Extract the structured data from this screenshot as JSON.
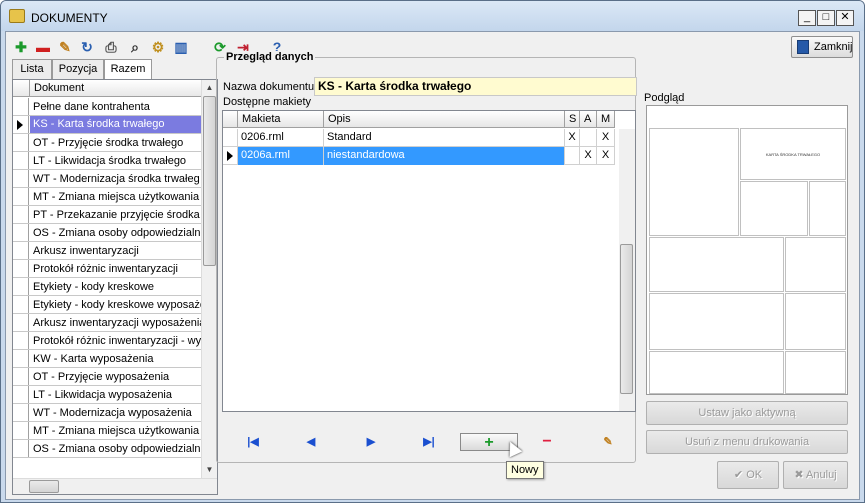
{
  "window": {
    "title": "DOKUMENTY",
    "minimize": "_",
    "maximize": "□",
    "close": "✕"
  },
  "toolbar": {
    "icons": [
      "add-icon",
      "remove-icon",
      "edit-icon",
      "refresh-doc-icon",
      "print-icon",
      "search-icon",
      "settings-icon",
      "columns-icon",
      "reload-icon",
      "import-icon",
      "help-icon"
    ],
    "close_label": "Zamknij"
  },
  "tabs": [
    {
      "label": "Lista"
    },
    {
      "label": "Pozycja"
    },
    {
      "label": "Razem"
    }
  ],
  "left_list": {
    "header": "Dokument",
    "rows": [
      "Pełne dane kontrahenta",
      "KS - Karta środka trwałego",
      "OT - Przyjęcie środka trwałego",
      "LT - Likwidacja środka trwałego",
      "WT - Modernizacja środka trwałeg",
      "MT - Zmiana miejsca użytkowania ś",
      "PT - Przekazanie przyjęcie środka t",
      "OS - Zmiana osoby odpowiedzialne",
      "Arkusz inwentaryzacji",
      "Protokół różnic inwentaryzacji",
      "Etykiety - kody kreskowe",
      "Etykiety - kody kreskowe wyposaże",
      "Arkusz inwentaryzacji wyposażenia",
      "Protokół różnic inwentaryzacji - wyp",
      "KW - Karta wyposażenia",
      "OT - Przyjęcie wyposażenia",
      "LT - Likwidacja wyposażenia",
      "WT - Modernizacja wyposażenia",
      "MT - Zmiana miejsca użytkowania w",
      "OS - Zmiana osoby odpowiedzialne"
    ],
    "selected_index": 1
  },
  "overview": {
    "title": "Przegląd danych",
    "doc_name_label": "Nazwa dokumentu",
    "doc_name_value": "KS - Karta środka trwałego",
    "templates_label": "Dostępne makiety",
    "columns": [
      "Makieta",
      "Opis",
      "S",
      "A",
      "M"
    ],
    "rows": [
      {
        "makieta": "0206.rml",
        "opis": "Standard",
        "s": "X",
        "a": "",
        "m": "X"
      },
      {
        "makieta": "0206a.rml",
        "opis": "niestandardowa",
        "s": "",
        "a": "X",
        "m": "X"
      }
    ],
    "selected_index": 1
  },
  "nav": {
    "first": "|◀",
    "prev": "◀",
    "next": "▶",
    "last": "▶|",
    "add": "+",
    "delete": "−"
  },
  "tooltip": "Nowy",
  "preview": {
    "label": "Podgląd",
    "title_text": "KARTA ŚRODKA TRWAŁEGO"
  },
  "actions": {
    "set_active": "Ustaw jako aktywną",
    "remove_print": "Usuń z menu drukowania",
    "ok": "OK",
    "cancel": "Anuluj"
  }
}
